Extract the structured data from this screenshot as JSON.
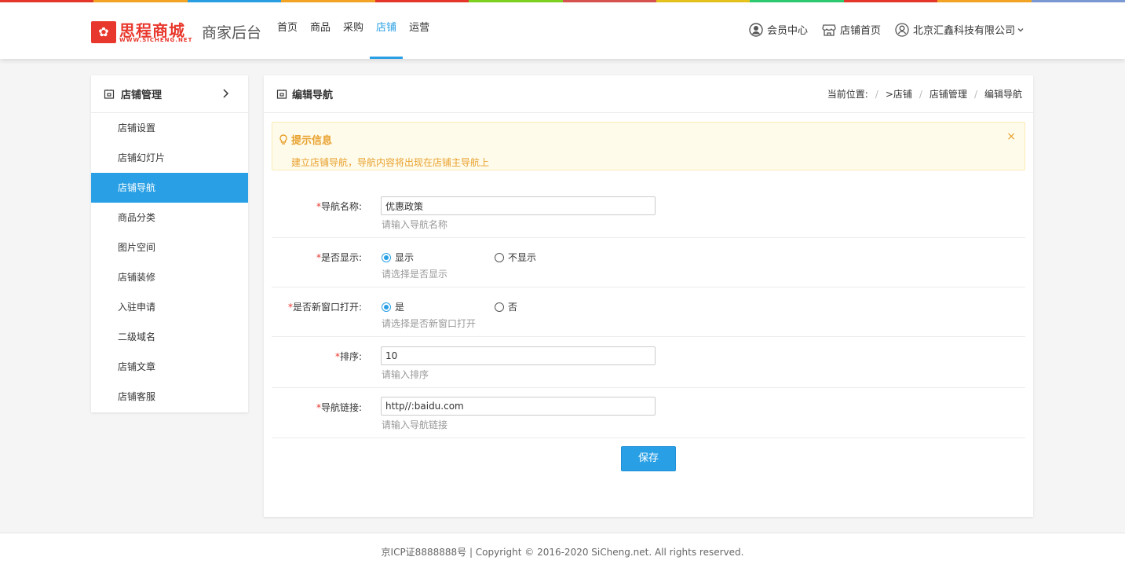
{
  "colors": {
    "accent": "#29a0e5",
    "brand": "#e8372c",
    "tip": "#e8a12e",
    "topstripe": [
      "#e8372c",
      "#f5a623",
      "#29a0e5",
      "#7ed321",
      "#e8372c",
      "#5cb85c",
      "#d9534f",
      "#f0ad4e",
      "#e8c51d",
      "#2ecc71",
      "#e8372c",
      "#9b59b6"
    ]
  },
  "header": {
    "logo_text": "思程商城",
    "logo_sub": "WWW.SICHENG.NET",
    "app_title": "商家后台",
    "nav": [
      {
        "label": "首页"
      },
      {
        "label": "商品"
      },
      {
        "label": "采购"
      },
      {
        "label": "店铺",
        "active": true
      },
      {
        "label": "运营"
      }
    ],
    "right": {
      "member_center": "会员中心",
      "shop_home": "店铺首页",
      "company": "北京汇鑫科技有限公司"
    }
  },
  "sidebar": {
    "title": "店铺管理",
    "items": [
      {
        "label": "店铺设置"
      },
      {
        "label": "店铺幻灯片"
      },
      {
        "label": "店铺导航",
        "active": true
      },
      {
        "label": "商品分类"
      },
      {
        "label": "图片空间"
      },
      {
        "label": "店铺装修"
      },
      {
        "label": "入驻申请"
      },
      {
        "label": "二级域名"
      },
      {
        "label": "店铺文章"
      },
      {
        "label": "店铺客服"
      }
    ]
  },
  "main": {
    "title": "编辑导航",
    "breadcrumb": {
      "prefix": "当前位置:",
      "items": [
        ">店铺",
        "店铺管理",
        "编辑导航"
      ]
    },
    "tip": {
      "title": "提示信息",
      "text": "建立店铺导航，导航内容将出现在店铺主导航上",
      "close": "×"
    },
    "form": {
      "name": {
        "label": "导航名称:",
        "value": "优惠政策",
        "help": "请输入导航名称"
      },
      "display": {
        "label": "是否显示:",
        "options": [
          "显示",
          "不显示"
        ],
        "selected": 0,
        "help": "请选择是否显示"
      },
      "new_window": {
        "label": "是否新窗口打开:",
        "options": [
          "是",
          "否"
        ],
        "selected": 0,
        "help": "请选择是否新窗口打开"
      },
      "sort": {
        "label": "排序:",
        "value": "10",
        "help": "请输入排序"
      },
      "link": {
        "label": "导航链接:",
        "value": "http//:baidu.com",
        "help": "请输入导航链接"
      },
      "required_mark": "*",
      "save": "保存"
    }
  },
  "footer": {
    "text": "京ICP证8888888号 | Copyright © 2016-2020 SiCheng.net. All rights reserved."
  }
}
